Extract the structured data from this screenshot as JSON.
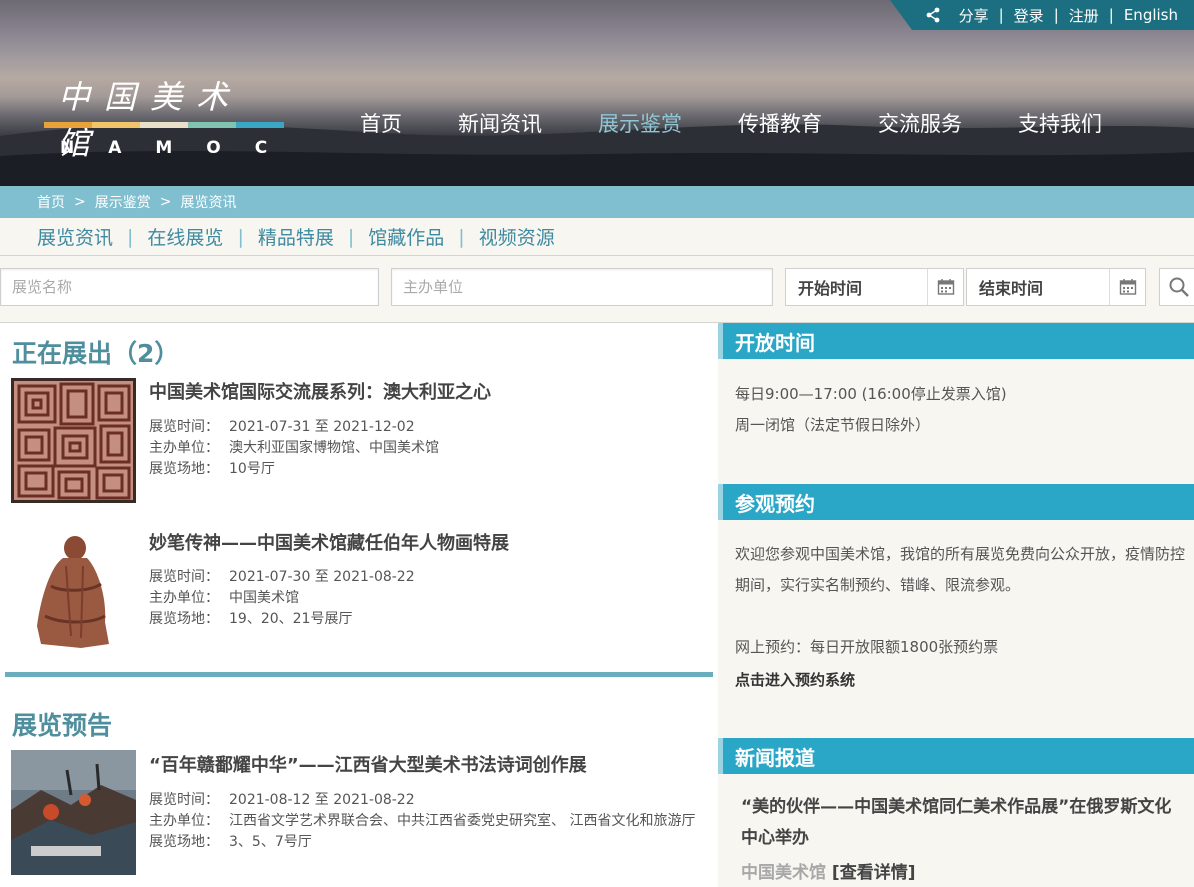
{
  "topbar": {
    "share": "分享",
    "login": "登录",
    "register": "注册",
    "english": "English"
  },
  "logo": {
    "chinese": "中国美术馆",
    "english": "NAMOC",
    "stripe_colors": [
      "#e8a23a",
      "#f2c46a",
      "#e8e0c8",
      "#7fc3b0",
      "#3aa6c4"
    ]
  },
  "nav": [
    "首页",
    "新闻资讯",
    "展示鉴赏",
    "传播教育",
    "交流服务",
    "支持我们"
  ],
  "nav_active": "展示鉴赏",
  "breadcrumb": [
    "首页",
    "展示鉴赏",
    "展览资讯"
  ],
  "breadcrumb_sep": ">",
  "subnav": [
    "展览资讯",
    "在线展览",
    "精品特展",
    "馆藏作品",
    "视频资源"
  ],
  "search": {
    "name_placeholder": "展览名称",
    "org_placeholder": "主办单位",
    "start_label": "开始时间",
    "end_label": "结束时间"
  },
  "current": {
    "title": "正在展出（2）",
    "items": [
      {
        "title": "中国美术馆国际交流展系列：澳大利亚之心",
        "time_label": "展览时间：",
        "time": "2021-07-31 至 2021-12-02",
        "org_label": "主办单位：",
        "org": "澳大利亚国家博物馆、中国美术馆",
        "venue_label": "展览场地：",
        "venue": "10号厅"
      },
      {
        "title": "妙笔传神——中国美术馆藏任伯年人物画特展",
        "time_label": "展览时间：",
        "time": "2021-07-30 至 2021-08-22",
        "org_label": "主办单位：",
        "org": "中国美术馆",
        "venue_label": "展览场地：",
        "venue": "19、20、21号展厅"
      }
    ]
  },
  "upcoming": {
    "title": "展览预告",
    "items": [
      {
        "title": "“百年赣鄱耀中华”——江西省大型美术书法诗词创作展",
        "time_label": "展览时间：",
        "time": "2021-08-12 至 2021-08-22",
        "org_label": "主办单位：",
        "org": "江西省文学艺术界联合会、中共江西省委党史研究室、 江西省文化和旅游厅",
        "venue_label": "展览场地：",
        "venue": "3、5、7号厅"
      }
    ]
  },
  "sidebar": {
    "hours_title": "开放时间",
    "hours_line1": "每日9:00—17:00 (16:00停止发票入馆)",
    "hours_line2": "周一闭馆（法定节假日除外）",
    "booking_title": "参观预约",
    "booking_text": "欢迎您参观中国美术馆，我馆的所有展览免费向公众开放，疫情防控期间，实行实名制预约、错峰、限流参观。",
    "booking_online": "网上预约：每日开放限额1800张预约票",
    "booking_link": "点击进入预约系统",
    "news_title": "新闻报道",
    "news_item": "“美的伙伴——中国美术馆同仁美术作品展”在俄罗斯文化中心举办",
    "news_source": "中国美术馆",
    "news_more": "[查看详情]"
  },
  "colors": {
    "accent": "#2aa6c6",
    "teal_text": "#4f8e9d",
    "breadcrumb_bg": "#7fbfcf",
    "topbar_bg": "#1b6f80"
  }
}
